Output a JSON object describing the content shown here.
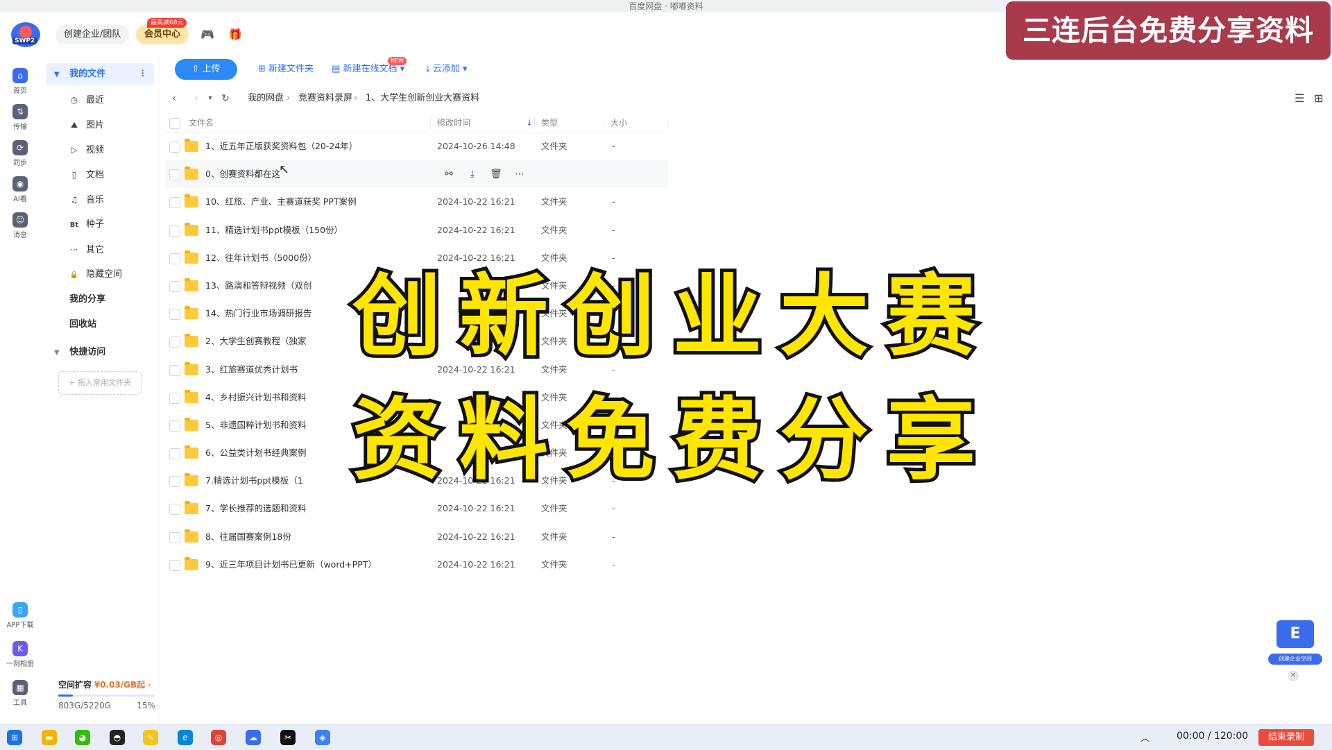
{
  "window": {
    "title": "百度网盘 · 嘟嘟资料"
  },
  "header": {
    "logo_text": "SWP2",
    "team_label": "创建企业/团队",
    "vip_label": "会员中心",
    "vip_badge": "最高减68元"
  },
  "promo_banner": "三连后台免费分享资料",
  "rail": {
    "items": [
      {
        "label": "首页",
        "icon": "home-icon"
      },
      {
        "label": "传输",
        "icon": "transfer-icon"
      },
      {
        "label": "同步",
        "icon": "sync-icon"
      },
      {
        "label": "AI看",
        "icon": "ai-icon"
      },
      {
        "label": "消息",
        "icon": "message-icon"
      }
    ],
    "bottom_items": [
      {
        "label": "APP下载",
        "icon": "phone-icon"
      },
      {
        "label": "一刻相册",
        "icon": "album-icon"
      },
      {
        "label": "工具",
        "icon": "tools-icon"
      }
    ]
  },
  "sidebar": {
    "my_files": "我的文件",
    "items": [
      {
        "label": "最近",
        "glyph": "◷"
      },
      {
        "label": "图片",
        "glyph": "⛰"
      },
      {
        "label": "视频",
        "glyph": "▷"
      },
      {
        "label": "文档",
        "glyph": "▯"
      },
      {
        "label": "音乐",
        "glyph": "♫"
      },
      {
        "label": "种子",
        "glyph": "Bt"
      },
      {
        "label": "其它",
        "glyph": "···"
      },
      {
        "label": "隐藏空间",
        "glyph": "🔒"
      }
    ],
    "my_share": "我的分享",
    "recycle": "回收站",
    "quick_access": "快捷访问",
    "drop_hint": "+ 拖入常用文件夹",
    "storage": {
      "label": "空间扩容",
      "price": "¥0.03/GB起",
      "used": "803G/5220G",
      "percent": "15%",
      "fraction": 0.15
    }
  },
  "toolbar": {
    "upload": "上传",
    "new_folder": "新建文件夹",
    "new_online_doc": "新建在线文档",
    "new_badge": "NEW",
    "cloud_add": "云添加"
  },
  "breadcrumb": [
    "我的网盘",
    "竞赛资料录屏",
    "1、大学生创新创业大赛资料"
  ],
  "table": {
    "headers": {
      "name": "文件名",
      "time": "修改时间",
      "type": "类型",
      "size": "大小"
    },
    "rows": [
      {
        "name": "1、近五年正版获奖资料包（20-24年）",
        "time": "2024-10-26 14:48",
        "type": "文件夹",
        "size": "-"
      },
      {
        "name": "0、创赛资料都在这",
        "time": "",
        "type": "",
        "size": ""
      },
      {
        "name": "10、红旅、产业、主赛道获奖 PPT案例",
        "time": "2024-10-22 16:21",
        "type": "文件夹",
        "size": "-"
      },
      {
        "name": "11、精选计划书ppt模板（150份）",
        "time": "2024-10-22 16:21",
        "type": "文件夹",
        "size": "-"
      },
      {
        "name": "12、往年计划书（5000份）",
        "time": "2024-10-22 16:21",
        "type": "文件夹",
        "size": "-"
      },
      {
        "name": "13、路演和答辩视频（双创",
        "time": "",
        "type": "文件夹",
        "size": "-"
      },
      {
        "name": "14、热门行业市场调研报告",
        "time": "",
        "type": "文件夹",
        "size": "-"
      },
      {
        "name": "2、大学生创赛教程（独家",
        "time": "",
        "type": "文件夹",
        "size": "-"
      },
      {
        "name": "3、红旅赛道优秀计划书",
        "time": "2024-10-22 16:21",
        "type": "文件夹",
        "size": "-"
      },
      {
        "name": "4、乡村振兴计划书和资料",
        "time": "",
        "type": "文件夹",
        "size": "-"
      },
      {
        "name": "5、非遗国粹计划书和资料",
        "time": "",
        "type": "文件夹",
        "size": "-"
      },
      {
        "name": "6、公益类计划书经典案例",
        "time": "",
        "type": "文件夹",
        "size": "-"
      },
      {
        "name": "7.精选计划书ppt模板（1",
        "time": "2024-10-22 16:21",
        "type": "文件夹",
        "size": "-"
      },
      {
        "name": "7、学长推荐的选题和资料",
        "time": "2024-10-22 16:21",
        "type": "文件夹",
        "size": "-"
      },
      {
        "name": "8、往届国赛案例18份",
        "time": "2024-10-22 16:21",
        "type": "文件夹",
        "size": "-"
      },
      {
        "name": "9、近三年项目计划书已更新（word+PPT）",
        "time": "2024-10-22 16:21",
        "type": "文件夹",
        "size": "-"
      }
    ]
  },
  "overlay": {
    "line1": "创新创业大赛",
    "line2": "资料免费分享"
  },
  "float_card": {
    "label": "创建企业空间"
  },
  "taskbar": {
    "record_time": "00:00 / 120:00",
    "stop_record": "结束录制"
  },
  "colors": {
    "accent": "#2b6ff6",
    "overlay_text": "#ffe600",
    "promo_bg": "#a83a4c"
  }
}
